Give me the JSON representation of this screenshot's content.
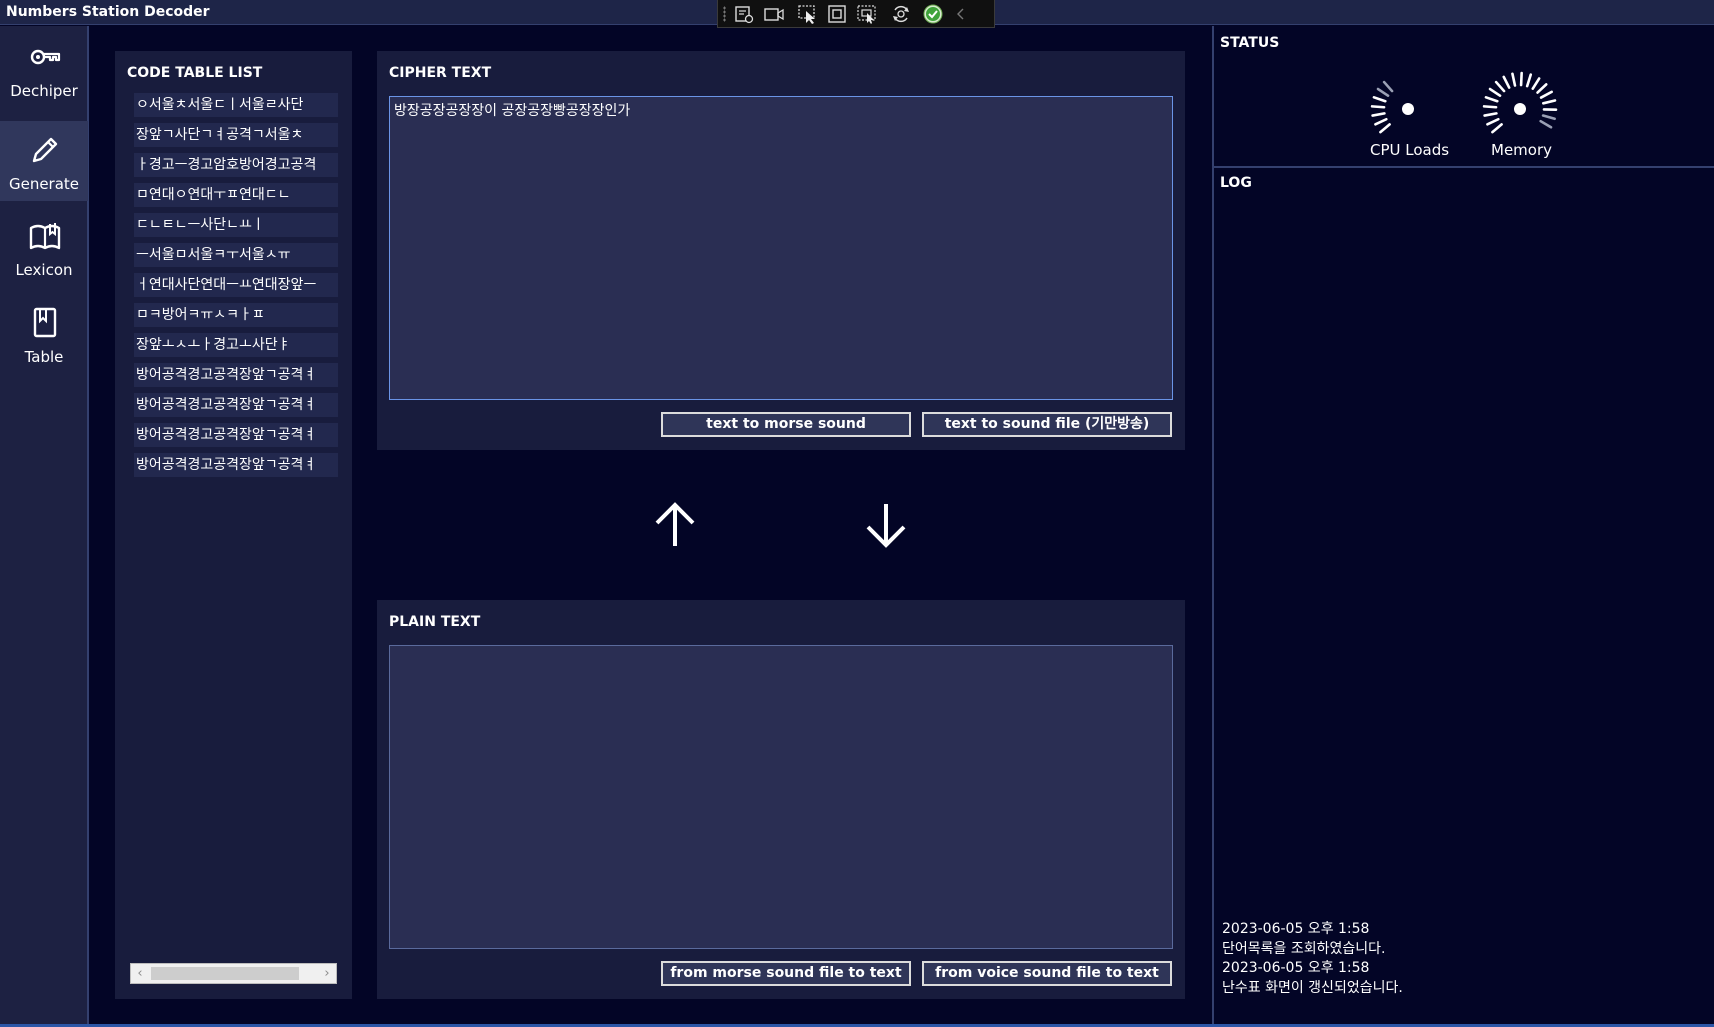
{
  "app": {
    "title": "Numbers Station Decoder"
  },
  "devtools": {
    "icons": [
      "live-tree-icon",
      "record-icon",
      "select-element-icon",
      "display-layout-icon",
      "track-focus-icon",
      "hot-reload-icon",
      "binding-check-icon",
      "collapse-chevron-icon"
    ]
  },
  "sidebar": {
    "items": [
      {
        "label": "Dechiper",
        "icon": "key-icon",
        "active": false
      },
      {
        "label": "Generate",
        "icon": "pencil-icon",
        "active": true
      },
      {
        "label": "Lexicon",
        "icon": "open-book-icon",
        "active": false
      },
      {
        "label": "Table",
        "icon": "bookmark-icon",
        "active": false
      }
    ]
  },
  "code_table": {
    "title": "CODE TABLE LIST",
    "items": [
      "ㅇ서울ㅊ서울ㄷㅣ서울ㄹ사단",
      "장앞ㄱ사단ㄱㅕ공격ㄱ서울ㅊ",
      "ㅏ경고ㅡ경고암호방어경고공격",
      "ㅁ연대ㅇ연대ㅜㅍ연대ㄷㄴ",
      "ㄷㄴㅌㄴㅡ사단ㄴㅛㅣ",
      "ㅡ서울ㅁ서울ㅋㅜ서울ㅅㅠ",
      "ㅓ연대사단연대ㅡㅛ연대장앞ㅡ",
      "ㅁㅋ방어ㅋㅠㅅㅋㅏㅍ",
      "장앞ㅗㅅㅗㅏ경고ㅗ사단ㅑ",
      "방어공격경고공격장앞ㄱ공격ㅕ",
      "방어공격경고공격장앞ㄱ공격ㅕ",
      "방어공격경고공격장앞ㄱ공격ㅕ",
      "방어공격경고공격장앞ㄱ공격ㅕ"
    ]
  },
  "cipher": {
    "title": "CIPHER TEXT",
    "text": "방장공장공장장이 공장공장빵공장장인가",
    "buttons": {
      "morse": "text to morse sound",
      "sound_file": "text to sound file (기만방송)"
    }
  },
  "plain": {
    "title": "PLAIN TEXT",
    "text": "",
    "buttons": {
      "from_morse": "from morse sound file to text",
      "from_voice": "from voice sound file to text"
    }
  },
  "status": {
    "title": "STATUS",
    "cpu_label": "CPU Loads",
    "memory_label": "Memory",
    "cpu_level": 0.35,
    "memory_level": 0.9
  },
  "log": {
    "title": "LOG",
    "lines": [
      "2023-06-05 오후 1:58",
      "단어목록을 조회하였습니다.",
      "2023-06-05 오후 1:58",
      "난수표 화면이 갱신되었습니다."
    ]
  },
  "colors": {
    "background": "#030526",
    "panel": "#181c3d",
    "sidebar": "#1d2142",
    "sidebar_active": "#30375c",
    "textbox": "#2a2e53",
    "accent_border": "#6a94e6"
  }
}
